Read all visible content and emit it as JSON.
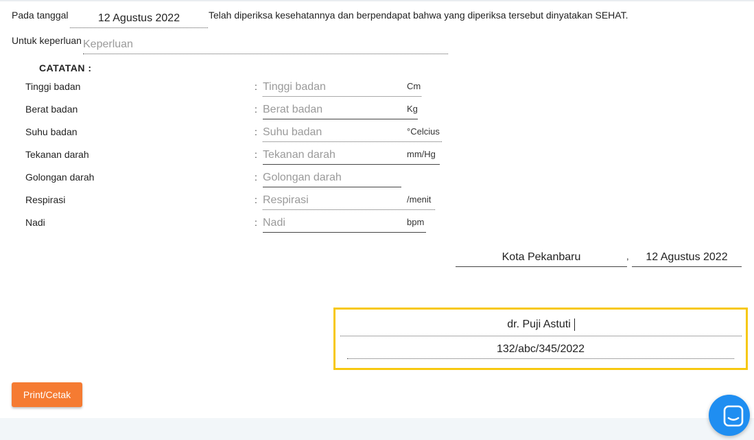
{
  "header": {
    "date_label": "Pada tanggal",
    "date_value": "12 Agustus 2022",
    "statement": "Telah diperiksa kesehatannya dan berpendapat bahwa yang diperiksa tersebut dinyatakan SEHAT.",
    "purpose_label": "Untuk keperluan",
    "purpose_placeholder": "Keperluan"
  },
  "notes": {
    "title": "CATATAN :",
    "colon": ":",
    "rows": [
      {
        "label": "Tinggi badan",
        "placeholder": "Tinggi badan",
        "unit": "Cm"
      },
      {
        "label": "Berat badan",
        "placeholder": "Berat badan",
        "unit": "Kg"
      },
      {
        "label": "Suhu badan",
        "placeholder": "Suhu badan",
        "unit": "°Celcius"
      },
      {
        "label": "Tekanan darah",
        "placeholder": "Tekanan darah",
        "unit": "mm/Hg"
      },
      {
        "label": "Golongan darah",
        "placeholder": "Golongan darah",
        "unit": ""
      },
      {
        "label": "Respirasi",
        "placeholder": "Respirasi",
        "unit": "/menit"
      },
      {
        "label": "Nadi",
        "placeholder": "Nadi",
        "unit": "bpm"
      }
    ]
  },
  "signing": {
    "city": "Kota Pekanbaru",
    "separator": ",",
    "date": "12 Agustus 2022",
    "doctor_name": "dr. Puji Astuti",
    "license_number": "132/abc/345/2022"
  },
  "actions": {
    "print_label": "Print/Cetak"
  },
  "widget": {
    "icon": "chat-icon",
    "color": "#1f8ef1"
  },
  "colors": {
    "highlight": "#f7c80f",
    "print_button": "#f57b32"
  }
}
